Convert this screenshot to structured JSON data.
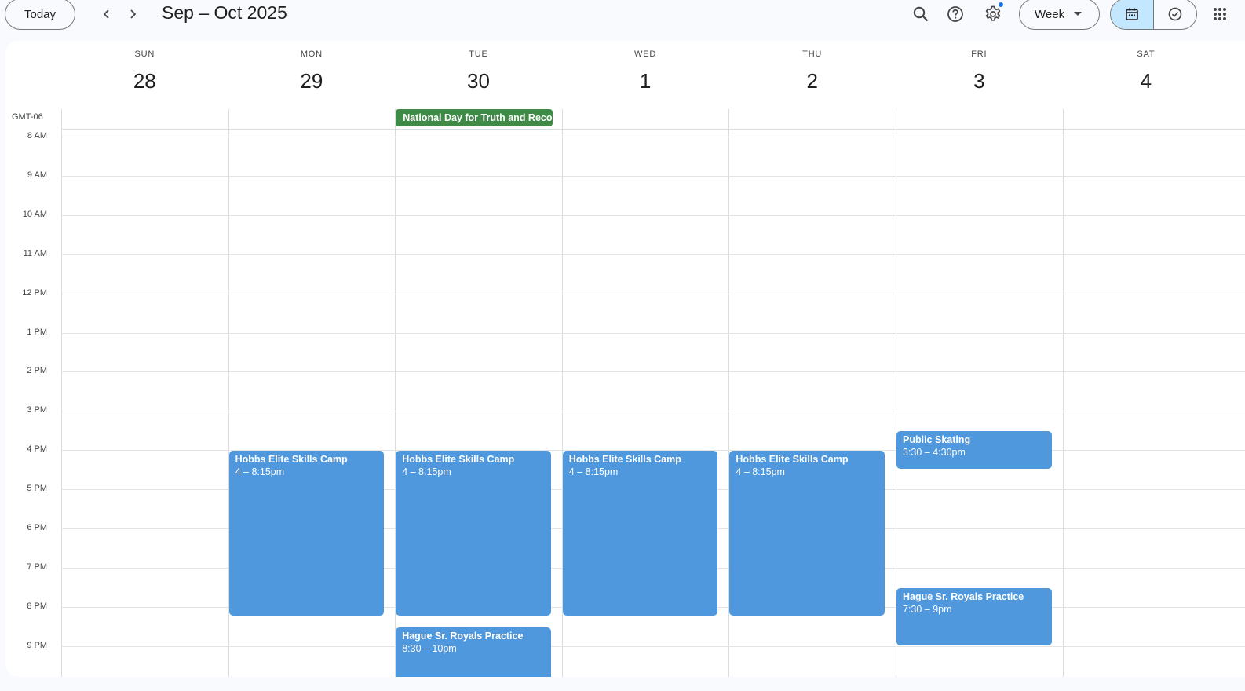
{
  "toolbar": {
    "today_label": "Today",
    "date_range": "Sep – Oct 2025",
    "view_label": "Week"
  },
  "icons": {
    "prev": "chevron-left-icon",
    "next": "chevron-right-icon",
    "search": "search-icon",
    "help": "help-icon",
    "settings": "gear-icon",
    "view_caret": "caret-down-icon",
    "calendar_view": "calendar-icon",
    "tasks_view": "task-check-icon",
    "apps": "apps-grid-icon"
  },
  "colors": {
    "accent_selected": "#c2e7ff",
    "event_blue": "#4f98dd",
    "holiday_green": "#3f8a47",
    "notification_dot": "#1a73e8"
  },
  "timezone": "GMT-06",
  "days": [
    {
      "name": "SUN",
      "num": "28"
    },
    {
      "name": "MON",
      "num": "29"
    },
    {
      "name": "TUE",
      "num": "30"
    },
    {
      "name": "WED",
      "num": "1"
    },
    {
      "name": "THU",
      "num": "2"
    },
    {
      "name": "FRI",
      "num": "3"
    },
    {
      "name": "SAT",
      "num": "4"
    }
  ],
  "hours": [
    {
      "label": "8 AM",
      "hour": 8
    },
    {
      "label": "9 AM",
      "hour": 9
    },
    {
      "label": "10 AM",
      "hour": 10
    },
    {
      "label": "11 AM",
      "hour": 11
    },
    {
      "label": "12 PM",
      "hour": 12
    },
    {
      "label": "1 PM",
      "hour": 13
    },
    {
      "label": "2 PM",
      "hour": 14
    },
    {
      "label": "3 PM",
      "hour": 15
    },
    {
      "label": "4 PM",
      "hour": 16
    },
    {
      "label": "5 PM",
      "hour": 17
    },
    {
      "label": "6 PM",
      "hour": 18
    },
    {
      "label": "7 PM",
      "hour": 19
    },
    {
      "label": "8 PM",
      "hour": 20
    },
    {
      "label": "9 PM",
      "hour": 21
    }
  ],
  "all_day_events": [
    {
      "title": "National Day for Truth and Reconciliation",
      "day": 2
    }
  ],
  "events": [
    {
      "title": "Hobbs Elite Skills Camp",
      "time": "4 – 8:15pm",
      "day": 1,
      "start": 16,
      "end": 20.25
    },
    {
      "title": "Hobbs Elite Skills Camp",
      "time": "4 – 8:15pm",
      "day": 2,
      "start": 16,
      "end": 20.25
    },
    {
      "title": "Hague Sr. Royals Practice",
      "time": "8:30 – 10pm",
      "day": 2,
      "start": 20.5,
      "end": 22
    },
    {
      "title": "Hobbs Elite Skills Camp",
      "time": "4 – 8:15pm",
      "day": 3,
      "start": 16,
      "end": 20.25
    },
    {
      "title": "Hobbs Elite Skills Camp",
      "time": "4 – 8:15pm",
      "day": 4,
      "start": 16,
      "end": 20.25
    },
    {
      "title": "Public Skating",
      "time": "3:30 – 4:30pm",
      "day": 5,
      "start": 15.5,
      "end": 16.5
    },
    {
      "title": "Hague Sr. Royals Practice",
      "time": "7:30 – 9pm",
      "day": 5,
      "start": 19.5,
      "end": 21
    }
  ]
}
